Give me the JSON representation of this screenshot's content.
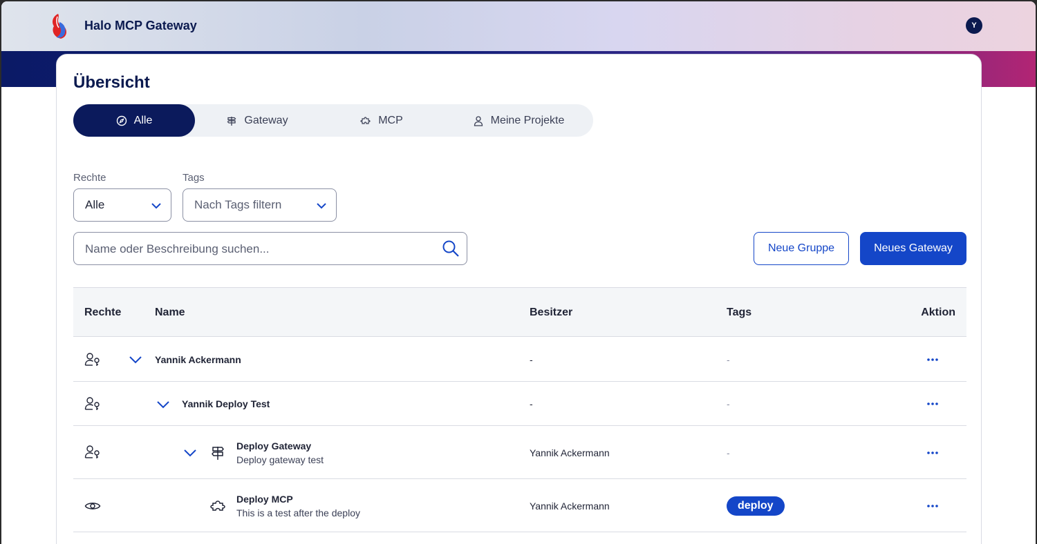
{
  "app": {
    "title": "Halo MCP Gateway",
    "user_initial": "Y"
  },
  "page": {
    "title": "Übersicht"
  },
  "tabs": [
    {
      "label": "Alle",
      "icon": "compass-icon",
      "active": true
    },
    {
      "label": "Gateway",
      "icon": "signpost-icon",
      "active": false
    },
    {
      "label": "MCP",
      "icon": "puzzle-icon",
      "active": false
    },
    {
      "label": "Meine Projekte",
      "icon": "user-icon",
      "active": false
    }
  ],
  "filters": {
    "rights_label": "Rechte",
    "rights_value": "Alle",
    "tags_label": "Tags",
    "tags_placeholder": "Nach Tags filtern"
  },
  "search": {
    "placeholder": "Name oder Beschreibung suchen..."
  },
  "actions": {
    "new_group": "Neue Gruppe",
    "new_gateway": "Neues Gateway"
  },
  "table": {
    "headers": {
      "rights": "Rechte",
      "name": "Name",
      "owner": "Besitzer",
      "tags": "Tags",
      "action": "Aktion"
    },
    "rows": [
      {
        "rights_icon": "user-key-icon",
        "name": "Yannik Ackermann",
        "description": "",
        "owner": "-",
        "tags": "-"
      },
      {
        "rights_icon": "user-key-icon",
        "name": "Yannik Deploy Test",
        "description": "",
        "owner": "-",
        "tags": "-"
      },
      {
        "rights_icon": "user-key-icon",
        "type_icon": "signpost-icon",
        "name": "Deploy Gateway",
        "description": "Deploy gateway test",
        "owner": "Yannik Ackermann",
        "tags": "-"
      },
      {
        "rights_icon": "eye-icon",
        "type_icon": "puzzle-icon",
        "name": "Deploy MCP",
        "description": "This is a test after the deploy",
        "owner": "Yannik Ackermann",
        "tag": "deploy"
      }
    ]
  },
  "colors": {
    "primary": "#1446c8",
    "navy": "#0b1a5c",
    "brand_pink": "#b22574"
  }
}
